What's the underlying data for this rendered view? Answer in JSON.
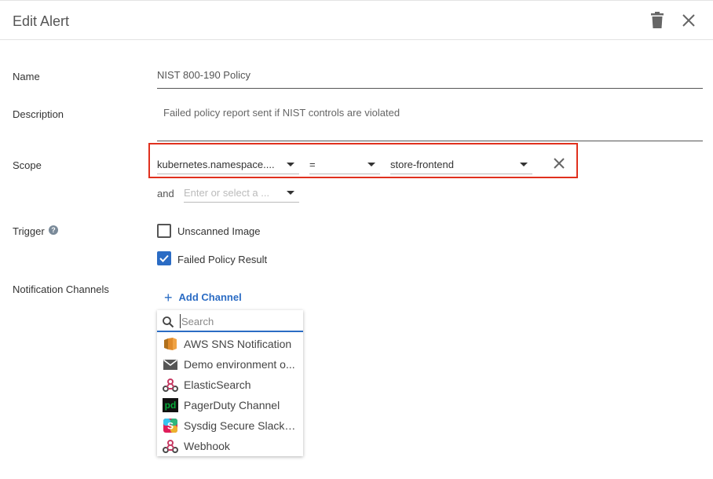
{
  "header": {
    "title": "Edit Alert"
  },
  "form": {
    "name_label": "Name",
    "name_value": "NIST 800-190 Policy",
    "description_label": "Description",
    "description_value": "Failed policy report sent if NIST controls are violated",
    "scope_label": "Scope",
    "scope_key": "kubernetes.namespace....",
    "scope_operator": "=",
    "scope_value": "store-frontend",
    "and_label": "and",
    "scope_next_placeholder": "Enter or select a ...",
    "trigger_label": "Trigger",
    "trigger_options": [
      {
        "label": "Unscanned Image",
        "checked": false
      },
      {
        "label": "Failed Policy Result",
        "checked": true
      }
    ],
    "notification_label": "Notification Channels",
    "add_channel_label": "Add Channel"
  },
  "dropdown": {
    "search_placeholder": "Search",
    "items": [
      {
        "label": "AWS SNS Notification",
        "icon": "aws-sns-icon"
      },
      {
        "label": "Demo environment o...",
        "icon": "email-icon"
      },
      {
        "label": "ElasticSearch",
        "icon": "webhook-icon"
      },
      {
        "label": "PagerDuty Channel",
        "icon": "pagerduty-icon"
      },
      {
        "label": "Sysdig Secure Slack I...",
        "icon": "slack-icon"
      },
      {
        "label": "Webhook",
        "icon": "webhook-icon"
      }
    ]
  },
  "colors": {
    "accent": "#2b6cc4",
    "scope_highlight": "#e0301e",
    "pagerduty": "#06ac38"
  }
}
